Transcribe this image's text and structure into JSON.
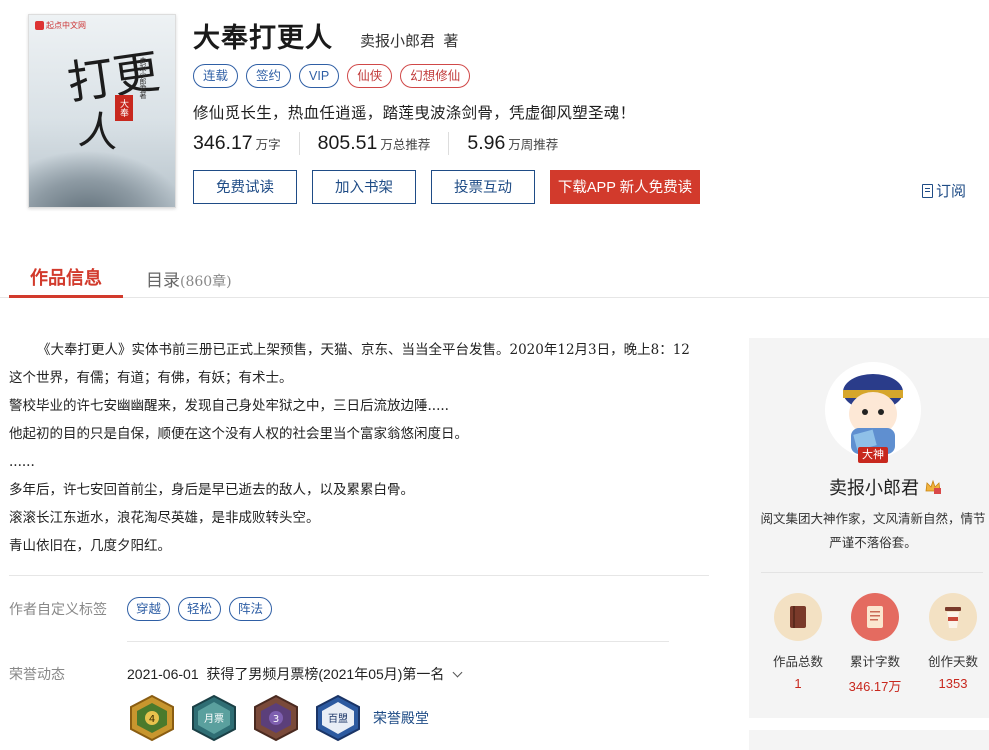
{
  "book": {
    "cover_title_glyphs": [
      "打更",
      "人"
    ],
    "cover_seal": "大奉",
    "cover_vertical": "卖报小郎君著",
    "cover_brand": "起点中文网",
    "title": "大奉打更人",
    "author": "卖报小郎君",
    "author_suffix": "著",
    "tags": [
      {
        "label": "连载",
        "color": "blue"
      },
      {
        "label": "签约",
        "color": "blue"
      },
      {
        "label": "VIP",
        "color": "blue"
      },
      {
        "label": "仙侠",
        "color": "red"
      },
      {
        "label": "幻想修仙",
        "color": "red"
      }
    ],
    "intro": "修仙觅长生，热血任逍遥，踏莲曳波涤剑骨，凭虚御风塑圣魂！",
    "stats": [
      {
        "value": "346.17",
        "unit": "万字"
      },
      {
        "value": "805.51",
        "unit": "万总推荐"
      },
      {
        "value": "5.96",
        "unit": "万周推荐"
      }
    ],
    "buttons": {
      "free_read": "免费试读",
      "add_shelf": "加入书架",
      "vote": "投票互动",
      "download_app": "下载APP 新人免费读"
    },
    "subscribe": "订阅"
  },
  "tabs": {
    "info": "作品信息",
    "catalog": "目录",
    "catalog_count": "(860章)"
  },
  "description": [
    "《大奉打更人》实体书前三册已正式上架预售，天猫、京东、当当全平台发售。2020年12月3日，晚上8：12",
    "这个世界，有儒；有道；有佛，有妖；有术士。",
    "警校毕业的许七安幽幽醒来，发现自己身处牢狱之中，三日后流放边陲.....",
    "他起初的目的只是自保，顺便在这个没有人权的社会里当个富家翁悠闲度日。",
    "......",
    "多年后，许七安回首前尘，身后是早已逝去的敌人，以及累累白骨。",
    "滚滚长江东逝水，浪花淘尽英雄，是非成败转头空。",
    "青山依旧在，几度夕阳红。"
  ],
  "custom_tags": {
    "label": "作者自定义标签",
    "items": [
      "穿越",
      "轻松",
      "阵法"
    ]
  },
  "honors": {
    "label": "荣誉动态",
    "latest": "2021-06-01  获得了男频月票榜(2021年05月)第一名",
    "badges": [
      {
        "name": "level-4-badge",
        "text": "4"
      },
      {
        "name": "monthly-ticket-badge",
        "text": "月票"
      },
      {
        "name": "level-3-badge",
        "text": "3"
      },
      {
        "name": "hundred-alliance-badge",
        "text": "百盟"
      }
    ],
    "hall_link": "荣誉殿堂"
  },
  "author_panel": {
    "badge": "大神",
    "name": "卖报小郎君",
    "bio": "阅文集团大神作家，文风清新自然，情节严谨不落俗套。",
    "stats": [
      {
        "label": "作品总数",
        "value": "1",
        "icon": "book-icon",
        "color": "#f3e1c3"
      },
      {
        "label": "累计字数",
        "value": "346.17万",
        "icon": "document-icon",
        "color": "#e46b60"
      },
      {
        "label": "创作天数",
        "value": "1353",
        "icon": "cup-icon",
        "color": "#f3e1c3"
      }
    ]
  },
  "colors": {
    "accent_red": "#d23a2c",
    "link_blue": "#1f4c86",
    "tag_blue": "#2f5fa5"
  }
}
